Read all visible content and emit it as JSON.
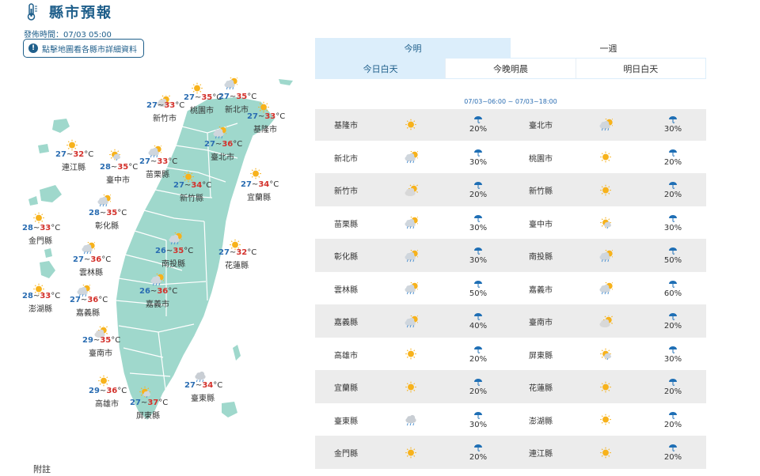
{
  "header": {
    "title": "縣市預報",
    "icon": "thermometer-icon"
  },
  "pubtime": "發佈時間：07/03 05:00",
  "map_button": {
    "label": "點擊地圖看各縣市詳細資料",
    "icon": "info-icon"
  },
  "colors": {
    "accent": "#1f5f8b",
    "low": "#2a6db2",
    "high": "#d3312b",
    "land": "#9fd8cc",
    "tab_active": "#dceefb"
  },
  "tabs": {
    "period": [
      "今明",
      "一週"
    ],
    "day": [
      "今日白天",
      "今晚明晨",
      "明日白天"
    ]
  },
  "range": "07/03~06:00 ~ 07/03~18:00",
  "unit": "°C",
  "map_cities": [
    {
      "name": "新竹市",
      "lo": "27",
      "hi": "33",
      "icon": "cloudy-sun-icon"
    },
    {
      "name": "桃園市",
      "lo": "27",
      "hi": "35",
      "icon": "sun-icon"
    },
    {
      "name": "新北市",
      "lo": "27",
      "hi": "35",
      "icon": "rain-sun-icon"
    },
    {
      "name": "基隆市",
      "lo": "27",
      "hi": "33",
      "icon": "sun-icon"
    },
    {
      "name": "連江縣",
      "lo": "27",
      "hi": "32",
      "icon": "sun-icon"
    },
    {
      "name": "臺中市",
      "lo": "28",
      "hi": "35",
      "icon": "sun-rain-icon"
    },
    {
      "name": "苗栗縣",
      "lo": "27",
      "hi": "33",
      "icon": "rain-sun-icon"
    },
    {
      "name": "臺北市",
      "lo": "27",
      "hi": "36",
      "icon": "rain-sun-icon"
    },
    {
      "name": "新竹縣",
      "lo": "27",
      "hi": "34",
      "icon": "sun-icon"
    },
    {
      "name": "宜蘭縣",
      "lo": "27",
      "hi": "34",
      "icon": "sun-icon"
    },
    {
      "name": "彰化縣",
      "lo": "28",
      "hi": "35",
      "icon": "rain-sun-icon"
    },
    {
      "name": "金門縣",
      "lo": "28",
      "hi": "33",
      "icon": "sun-icon"
    },
    {
      "name": "雲林縣",
      "lo": "27",
      "hi": "36",
      "icon": "rain-sun-icon"
    },
    {
      "name": "南投縣",
      "lo": "26",
      "hi": "35",
      "icon": "rain-sun-icon"
    },
    {
      "name": "花蓮縣",
      "lo": "27",
      "hi": "32",
      "icon": "sun-icon"
    },
    {
      "name": "澎湖縣",
      "lo": "28",
      "hi": "33",
      "icon": "sun-icon"
    },
    {
      "name": "嘉義縣",
      "lo": "27",
      "hi": "36",
      "icon": "rain-sun-icon"
    },
    {
      "name": "嘉義市",
      "lo": "26",
      "hi": "36",
      "icon": "rain-sun-icon"
    },
    {
      "name": "臺南市",
      "lo": "29",
      "hi": "35",
      "icon": "cloudy-sun-icon"
    },
    {
      "name": "高雄市",
      "lo": "29",
      "hi": "36",
      "icon": "sun-icon"
    },
    {
      "name": "屏東縣",
      "lo": "27",
      "hi": "37",
      "icon": "sun-rain-icon"
    },
    {
      "name": "臺東縣",
      "lo": "27",
      "hi": "34",
      "icon": "cloud-rain-icon"
    }
  ],
  "table": [
    [
      {
        "city": "基隆市",
        "icon": "sun-icon",
        "pop": "20%"
      },
      {
        "city": "臺北市",
        "icon": "rain-sun-icon",
        "pop": "30%"
      }
    ],
    [
      {
        "city": "新北市",
        "icon": "rain-sun-icon",
        "pop": "30%"
      },
      {
        "city": "桃園市",
        "icon": "sun-icon",
        "pop": "20%"
      }
    ],
    [
      {
        "city": "新竹市",
        "icon": "cloudy-sun-icon",
        "pop": "20%"
      },
      {
        "city": "新竹縣",
        "icon": "sun-icon",
        "pop": "20%"
      }
    ],
    [
      {
        "city": "苗栗縣",
        "icon": "rain-sun-icon",
        "pop": "30%"
      },
      {
        "city": "臺中市",
        "icon": "sun-rain-icon",
        "pop": "30%"
      }
    ],
    [
      {
        "city": "彰化縣",
        "icon": "rain-sun-icon",
        "pop": "30%"
      },
      {
        "city": "南投縣",
        "icon": "rain-sun-icon",
        "pop": "50%"
      }
    ],
    [
      {
        "city": "雲林縣",
        "icon": "rain-sun-icon",
        "pop": "50%"
      },
      {
        "city": "嘉義市",
        "icon": "rain-sun-icon",
        "pop": "60%"
      }
    ],
    [
      {
        "city": "嘉義縣",
        "icon": "rain-sun-icon",
        "pop": "40%"
      },
      {
        "city": "臺南市",
        "icon": "cloudy-sun-icon",
        "pop": "20%"
      }
    ],
    [
      {
        "city": "高雄市",
        "icon": "sun-icon",
        "pop": "20%"
      },
      {
        "city": "屏東縣",
        "icon": "sun-rain-icon",
        "pop": "30%"
      }
    ],
    [
      {
        "city": "宜蘭縣",
        "icon": "sun-icon",
        "pop": "20%"
      },
      {
        "city": "花蓮縣",
        "icon": "sun-icon",
        "pop": "20%"
      }
    ],
    [
      {
        "city": "臺東縣",
        "icon": "cloud-rain-icon",
        "pop": "30%"
      },
      {
        "city": "澎湖縣",
        "icon": "sun-icon",
        "pop": "20%"
      }
    ],
    [
      {
        "city": "金門縣",
        "icon": "sun-icon",
        "pop": "20%"
      },
      {
        "city": "連江縣",
        "icon": "sun-icon",
        "pop": "20%"
      }
    ]
  ],
  "footnote": "附註"
}
